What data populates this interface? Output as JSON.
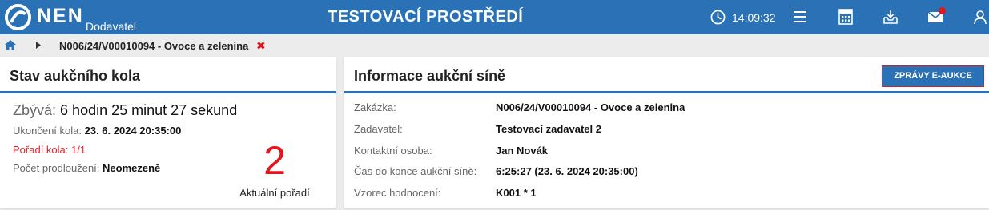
{
  "header": {
    "logo_text": "NEN",
    "logo_sub": "Dodavatel",
    "environment": "TESTOVACÍ PROSTŘEDÍ",
    "time": "14:09:32",
    "icons": [
      "clock-icon",
      "menu-icon",
      "calculator-icon",
      "inbox-download-icon",
      "mail-icon",
      "user-icon"
    ],
    "brand_color": "#2a72b5",
    "notification_color": "#e3161d"
  },
  "breadcrumb": {
    "current": "N006/24/V00010094 - Ovoce a zelenina",
    "close": "✖"
  },
  "round_status": {
    "title": "Stav aukčního kola",
    "remaining_label": "Zbývá:",
    "remaining_value": "6 hodin 25 minut 27 sekund",
    "end_label": "Ukončení kola:",
    "end_value": "23. 6. 2024 20:35:00",
    "order_label": "Pořadí kola:",
    "order_value": "1/1",
    "extensions_label": "Počet prodloužení:",
    "extensions_value": "Neomezeně",
    "rank": "2",
    "rank_label": "Aktuální pořadí"
  },
  "auction_info": {
    "title": "Informace aukční síně",
    "messages_button": "ZPRÁVY E-AUKCE",
    "rows": [
      {
        "label": "Zakázka:",
        "value": "N006/24/V00010094 - Ovoce a zelenina"
      },
      {
        "label": "Zadavatel:",
        "value": "Testovací zadavatel 2"
      },
      {
        "label": "Kontaktní osoba:",
        "value": "Jan Novák"
      },
      {
        "label": "Čas do konce aukční síně:",
        "value": "6:25:27 (23. 6. 2024 20:35:00)"
      },
      {
        "label": "Vzorec hodnocení:",
        "value": "K001 * 1"
      }
    ]
  }
}
